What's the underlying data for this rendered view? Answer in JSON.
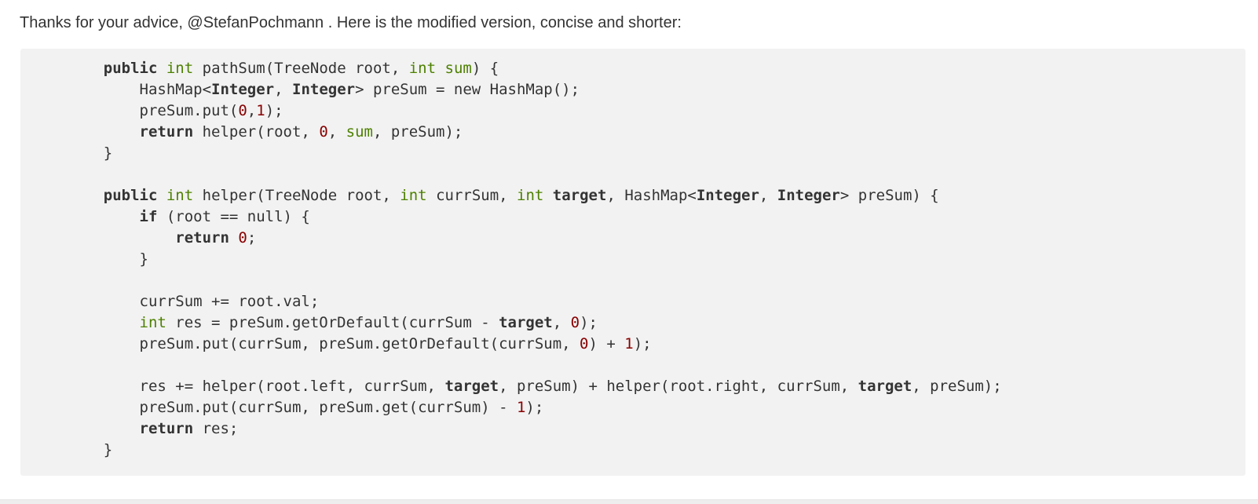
{
  "post": {
    "intro_text": "Thanks for your advice, @StefanPochmann . Here is the modified version, concise and shorter:"
  },
  "code": {
    "language": "java",
    "lines": [
      [
        {
          "t": "    "
        },
        {
          "t": "public",
          "c": "kw"
        },
        {
          "t": " "
        },
        {
          "t": "int",
          "c": "ty"
        },
        {
          "t": " pathSum(TreeNode root, "
        },
        {
          "t": "int",
          "c": "ty"
        },
        {
          "t": " "
        },
        {
          "t": "sum",
          "c": "ident"
        },
        {
          "t": ") {"
        }
      ],
      [
        {
          "t": "        HashMap<"
        },
        {
          "t": "Integer",
          "c": "kw"
        },
        {
          "t": ", "
        },
        {
          "t": "Integer",
          "c": "kw"
        },
        {
          "t": "> preSum = new HashMap();"
        }
      ],
      [
        {
          "t": "        preSum.put("
        },
        {
          "t": "0",
          "c": "num"
        },
        {
          "t": ","
        },
        {
          "t": "1",
          "c": "num"
        },
        {
          "t": ");"
        }
      ],
      [
        {
          "t": "        "
        },
        {
          "t": "return",
          "c": "kw"
        },
        {
          "t": " helper(root, "
        },
        {
          "t": "0",
          "c": "num"
        },
        {
          "t": ", "
        },
        {
          "t": "sum",
          "c": "ident"
        },
        {
          "t": ", preSum);"
        }
      ],
      [
        {
          "t": "    }"
        }
      ],
      [
        {
          "t": ""
        }
      ],
      [
        {
          "t": "    "
        },
        {
          "t": "public",
          "c": "kw"
        },
        {
          "t": " "
        },
        {
          "t": "int",
          "c": "ty"
        },
        {
          "t": " helper(TreeNode root, "
        },
        {
          "t": "int",
          "c": "ty"
        },
        {
          "t": " currSum, "
        },
        {
          "t": "int",
          "c": "ty"
        },
        {
          "t": " "
        },
        {
          "t": "target",
          "c": "tgt"
        },
        {
          "t": ", HashMap<"
        },
        {
          "t": "Integer",
          "c": "kw"
        },
        {
          "t": ", "
        },
        {
          "t": "Integer",
          "c": "kw"
        },
        {
          "t": "> preSum) {"
        }
      ],
      [
        {
          "t": "        "
        },
        {
          "t": "if",
          "c": "kw"
        },
        {
          "t": " (root == null) {"
        }
      ],
      [
        {
          "t": "            "
        },
        {
          "t": "return",
          "c": "kw"
        },
        {
          "t": " "
        },
        {
          "t": "0",
          "c": "num"
        },
        {
          "t": ";"
        }
      ],
      [
        {
          "t": "        }"
        }
      ],
      [
        {
          "t": ""
        }
      ],
      [
        {
          "t": "        currSum += root.val;"
        }
      ],
      [
        {
          "t": "        "
        },
        {
          "t": "int",
          "c": "ty"
        },
        {
          "t": " res = preSum.getOrDefault(currSum - "
        },
        {
          "t": "target",
          "c": "tgt"
        },
        {
          "t": ", "
        },
        {
          "t": "0",
          "c": "num"
        },
        {
          "t": ");"
        }
      ],
      [
        {
          "t": "        preSum.put(currSum, preSum.getOrDefault(currSum, "
        },
        {
          "t": "0",
          "c": "num"
        },
        {
          "t": ") + "
        },
        {
          "t": "1",
          "c": "num"
        },
        {
          "t": ");"
        }
      ],
      [
        {
          "t": ""
        }
      ],
      [
        {
          "t": "        res += helper(root.left, currSum, "
        },
        {
          "t": "target",
          "c": "tgt"
        },
        {
          "t": ", preSum) + helper(root.right, currSum, "
        },
        {
          "t": "target",
          "c": "tgt"
        },
        {
          "t": ", preSum);"
        }
      ],
      [
        {
          "t": "        preSum.put(currSum, preSum.get(currSum) - "
        },
        {
          "t": "1",
          "c": "num"
        },
        {
          "t": ");"
        }
      ],
      [
        {
          "t": "        "
        },
        {
          "t": "return",
          "c": "kw"
        },
        {
          "t": " res;"
        }
      ],
      [
        {
          "t": "    }"
        }
      ]
    ]
  },
  "colors": {
    "text": "#333333",
    "code_background": "#f2f2f2",
    "type_keyword": "#4d8000",
    "number_literal": "#880000"
  }
}
